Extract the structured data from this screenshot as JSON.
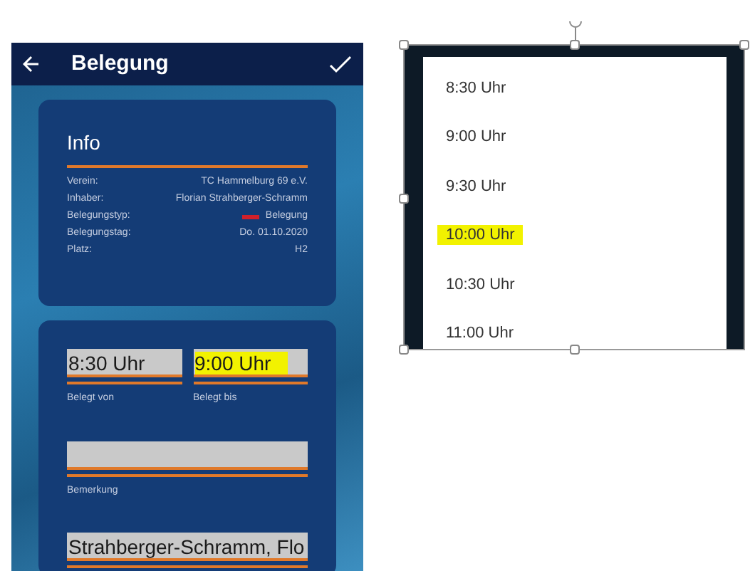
{
  "left_screen": {
    "title": "Belegung",
    "info": {
      "heading": "Info",
      "rows": [
        {
          "label": "Verein:",
          "value": "TC Hammelburg 69 e.V."
        },
        {
          "label": "Inhaber:",
          "value": "Florian Strahberger-Schramm"
        },
        {
          "label": "Belegungstyp:",
          "value": "Belegung",
          "color": "#d0202a"
        },
        {
          "label": "Belegungstag:",
          "value": "Do. 01.10.2020"
        },
        {
          "label": "Platz:",
          "value": "H2"
        }
      ]
    },
    "time_fields": [
      {
        "value": "8:30 Uhr",
        "label": "Belegt von",
        "highlighted": false
      },
      {
        "value": "9:00 Uhr",
        "label": "Belegt bis",
        "highlighted": true
      }
    ],
    "remark_field": {
      "label": "Bemerkung"
    },
    "name_field": {
      "value": "Strahberger-Schramm, Flo"
    }
  },
  "right_screen": {
    "time_options": [
      {
        "label": "8:30 Uhr",
        "highlighted": false
      },
      {
        "label": "9:00 Uhr",
        "highlighted": false
      },
      {
        "label": "9:30 Uhr",
        "highlighted": false
      },
      {
        "label": "10:00 Uhr",
        "highlighted": true
      },
      {
        "label": "10:30 Uhr",
        "highlighted": false
      },
      {
        "label": "11:00 Uhr",
        "highlighted": false
      }
    ]
  }
}
